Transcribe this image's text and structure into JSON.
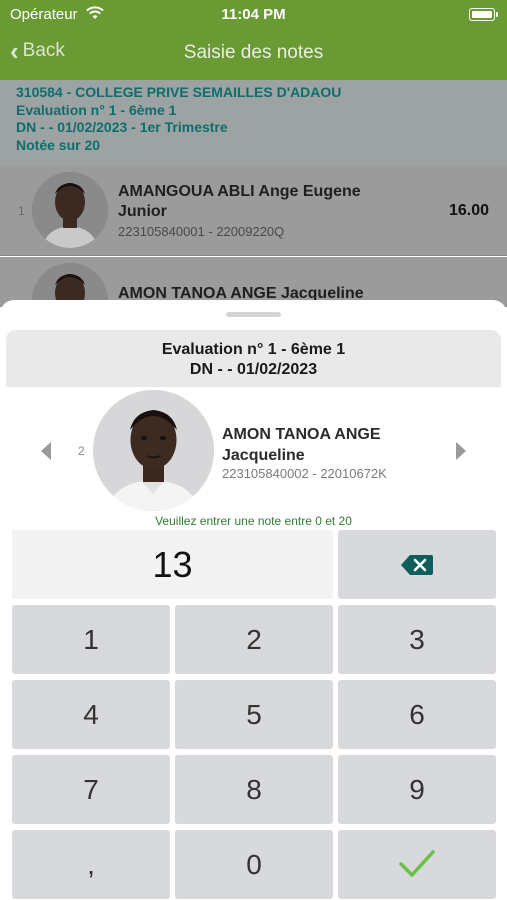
{
  "status": {
    "carrier": "Opérateur",
    "time": "11:04 PM"
  },
  "nav": {
    "back_label": "Back",
    "title": "Saisie des notes"
  },
  "info": {
    "lines": [
      "310584 - COLLEGE PRIVE SEMAILLES D'ADAOU",
      "Evaluation n° 1 - 6ème 1",
      "DN -  - 01/02/2023 - 1er Trimestre",
      "Notée sur 20"
    ]
  },
  "students": [
    {
      "num": "1",
      "name_line1": "AMANGOUA ABLI Ange Eugene",
      "name_line2": "Junior",
      "ids": "223105840001 - 22009220Q",
      "grade": "16.00"
    },
    {
      "num": "2",
      "name_line1": "AMON TANOA ANGE Jacqueline"
    }
  ],
  "sheet": {
    "eval_line1": "Evaluation n° 1 - 6ème 1",
    "eval_line2": "DN -  - 01/02/2023",
    "student_num": "2",
    "student_name_line1": "AMON TANOA ANGE",
    "student_name_line2": "Jacqueline",
    "student_ids": "223105840002 - 22010672K",
    "hint": "Veuillez entrer une note entre 0 et 20",
    "entered_value": "13"
  },
  "keypad": {
    "keys": [
      "1",
      "2",
      "3",
      "4",
      "5",
      "6",
      "7",
      "8",
      "9",
      ",",
      "0"
    ],
    "backspace_icon": "backspace-icon",
    "confirm_icon": "checkmark-icon"
  },
  "colors": {
    "header_green": "#6a9a34",
    "accent_teal": "#0e6e6e",
    "hint_green": "#2e7d32",
    "check_green": "#6cc04a"
  }
}
